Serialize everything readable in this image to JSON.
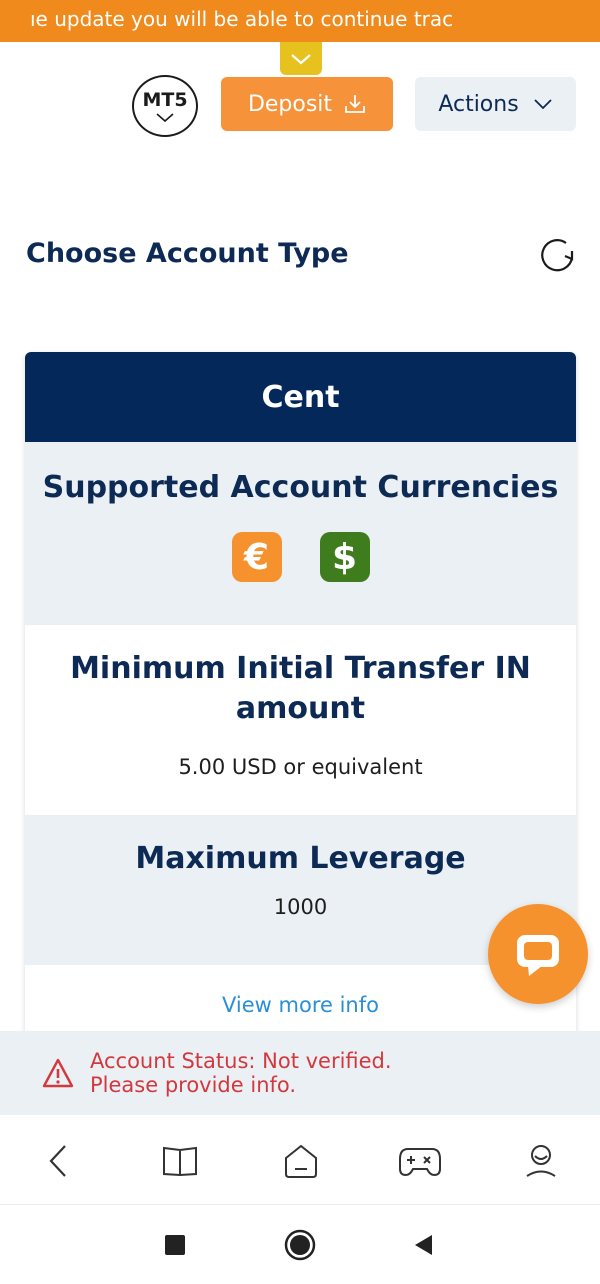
{
  "banner": {
    "text": "ıe update you will be able to continue trac"
  },
  "toolbar": {
    "platform_label": "MT5",
    "deposit_label": "Deposit",
    "actions_label": "Actions"
  },
  "page": {
    "section_title": "Choose Account Type"
  },
  "account_card": {
    "title": "Cent",
    "currencies_heading": "Supported Account Currencies",
    "currencies": [
      {
        "symbol": "€",
        "color": "#f5922d"
      },
      {
        "symbol": "$",
        "color": "#3e7c1e"
      }
    ],
    "min_transfer_heading": "Minimum Initial Transfer IN amount",
    "min_transfer_value": "5.00 USD or equivalent",
    "leverage_heading": "Maximum Leverage",
    "leverage_value": "1000",
    "view_more_label": "View more info"
  },
  "status": {
    "line1": "Account Status: Not verified.",
    "line2": "Please provide info."
  },
  "colors": {
    "accent_orange": "#f08a1c",
    "navy": "#05285a",
    "alert_red": "#d2393f",
    "link_blue": "#2b8fd6"
  },
  "icons": {
    "bottom_nav": [
      "back-icon",
      "book-icon",
      "home-icon",
      "gamepad-icon",
      "profile-icon"
    ],
    "system_nav": [
      "recents-icon",
      "home-circle-icon",
      "back-triangle-icon"
    ]
  }
}
